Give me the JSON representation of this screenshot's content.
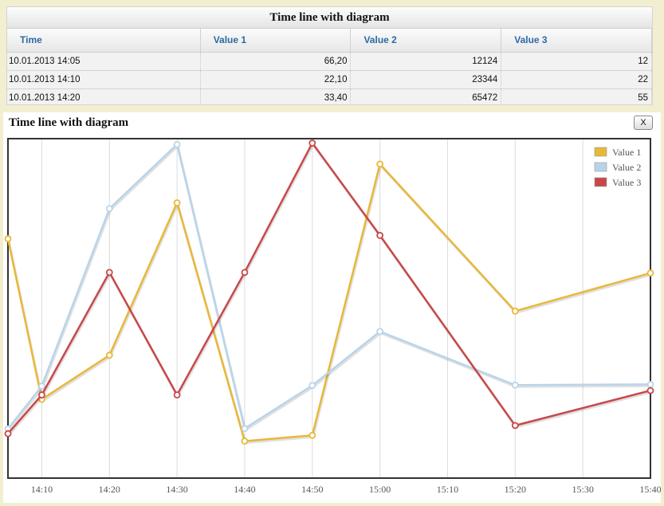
{
  "grid": {
    "title": "Time line with diagram",
    "columns": [
      "Time",
      "Value 1",
      "Value 2",
      "Value 3"
    ],
    "rows": [
      [
        "10.01.2013 14:05",
        "66,20",
        "12124",
        "12"
      ],
      [
        "10.01.2013 14:10",
        "22,10",
        "23344",
        "22"
      ],
      [
        "10.01.2013 14:20",
        "33,40",
        "65472",
        "55"
      ]
    ]
  },
  "dialog": {
    "title": "Time line with diagram",
    "close_label": "X"
  },
  "chart_data": {
    "type": "line",
    "x": [
      "14:05",
      "14:10",
      "14:20",
      "14:30",
      "14:40",
      "14:50",
      "15:00",
      "15:20",
      "15:40"
    ],
    "x_ticks": [
      "14:10",
      "14:20",
      "14:30",
      "14:40",
      "14:50",
      "15:00",
      "15:10",
      "15:20",
      "15:30",
      "15:40"
    ],
    "x_range": [
      "14:05",
      "15:40"
    ],
    "grid": true,
    "legend_position": "top-right",
    "series": [
      {
        "name": "Value 1",
        "color": "#e8b838",
        "values": [
          70.5,
          23.2,
          36.2,
          81.1,
          10.9,
          12.6,
          92.5,
          49.2,
          60.4
        ]
      },
      {
        "name": "Value 2",
        "color": "#b9d4ea",
        "values": [
          14.5,
          27.1,
          79.4,
          98.3,
          14.6,
          27.3,
          43.2,
          27.4,
          27.6
        ]
      },
      {
        "name": "Value 3",
        "color": "#c8484a",
        "values": [
          13.1,
          24.5,
          60.6,
          24.5,
          60.6,
          98.7,
          71.5,
          15.5,
          25.8
        ]
      }
    ]
  }
}
